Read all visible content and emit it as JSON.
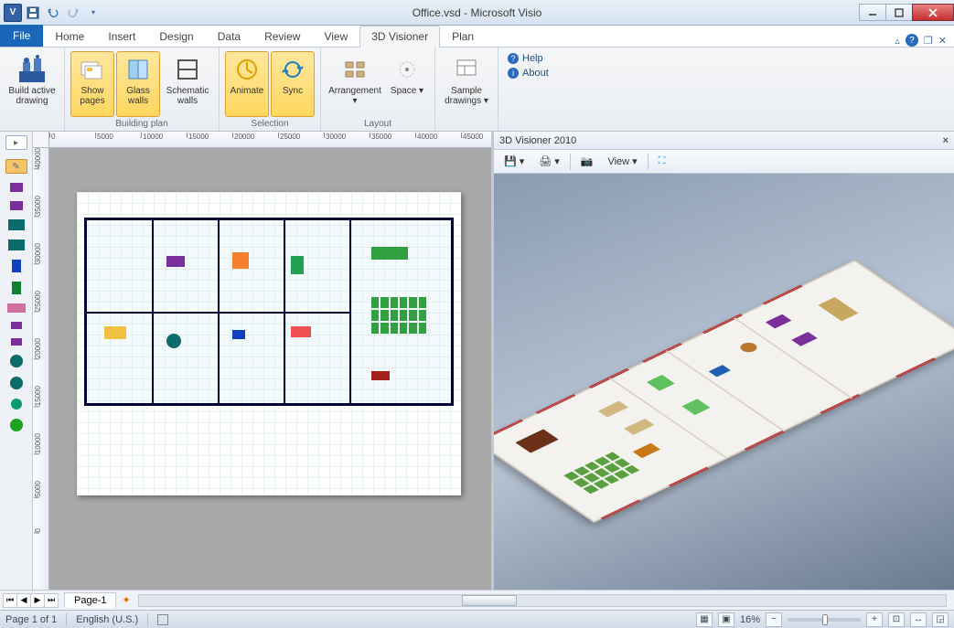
{
  "titlebar": {
    "app_icon_letter": "V",
    "title": "Office.vsd - Microsoft Visio"
  },
  "tabs": {
    "file": "File",
    "items": [
      "Home",
      "Insert",
      "Design",
      "Data",
      "Review",
      "View",
      "3D Visioner",
      "Plan"
    ],
    "active_index": 6
  },
  "ribbon": {
    "build": {
      "label": "Build active drawing"
    },
    "building_plan": {
      "group_label": "Building plan",
      "show_pages": "Show pages",
      "glass_walls": "Glass walls",
      "schematic_walls": "Schematic walls"
    },
    "selection": {
      "group_label": "Selection",
      "animate": "Animate",
      "sync": "Sync"
    },
    "layout": {
      "group_label": "Layout",
      "arrangement": "Arrangement",
      "space": "Space"
    },
    "samples": {
      "label": "Sample drawings"
    },
    "help": {
      "help": "Help",
      "about": "About"
    }
  },
  "ruler_h": [
    "0",
    "5000",
    "10000",
    "15000",
    "20000",
    "25000",
    "30000",
    "35000",
    "40000",
    "45000"
  ],
  "ruler_v": [
    "40000",
    "35000",
    "30000",
    "25000",
    "20000",
    "15000",
    "10000",
    "5000",
    "0"
  ],
  "visioner_pane": {
    "title": "3D Visioner 2010",
    "view_label": "View"
  },
  "pagetabs": {
    "page1": "Page-1"
  },
  "statusbar": {
    "page_info": "Page 1 of 1",
    "language": "English (U.S.)",
    "zoom": "16%"
  },
  "stencil_shapes": [
    {
      "name": "desk-purple",
      "bg": "#7a2f9a",
      "w": 14,
      "h": 10
    },
    {
      "name": "desk-purple-2",
      "bg": "#7a2f9a",
      "w": 14,
      "h": 10
    },
    {
      "name": "table-teal",
      "bg": "#0b6a6a",
      "w": 18,
      "h": 12
    },
    {
      "name": "table-teal-2",
      "bg": "#0b6a6a",
      "w": 18,
      "h": 12
    },
    {
      "name": "cabinet-blue",
      "bg": "#1040c0",
      "w": 10,
      "h": 14
    },
    {
      "name": "cabinet-green",
      "bg": "#108030",
      "w": 10,
      "h": 14
    },
    {
      "name": "sofa-pink",
      "bg": "#d070a0",
      "w": 20,
      "h": 10
    },
    {
      "name": "chair-purple",
      "bg": "#7a2f9a",
      "w": 12,
      "h": 8
    },
    {
      "name": "chair-purple-2",
      "bg": "#7a2f9a",
      "w": 12,
      "h": 8
    },
    {
      "name": "round-teal",
      "bg": "#0b6a6a",
      "w": 14,
      "h": 14
    },
    {
      "name": "round-teal-2",
      "bg": "#0b6a6a",
      "w": 14,
      "h": 14
    },
    {
      "name": "plant-teal",
      "bg": "#0b9a6a",
      "w": 12,
      "h": 12
    },
    {
      "name": "plant-green",
      "bg": "#20a020",
      "w": 14,
      "h": 14
    }
  ]
}
